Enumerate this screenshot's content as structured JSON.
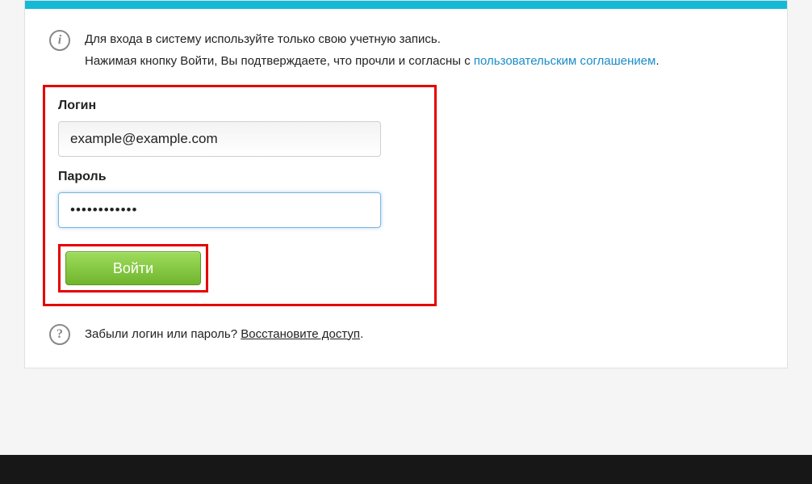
{
  "info": {
    "line1": "Для входа в систему используйте только свою учетную запись.",
    "line2_prefix": "Нажимая кнопку Войти, Вы подтверждаете, что прочли и согласны с ",
    "link_text": "пользовательским соглашением",
    "line2_suffix": "."
  },
  "form": {
    "login_label": "Логин",
    "login_value": "example@example.com",
    "password_label": "Пароль",
    "password_value": "••••••••••••",
    "submit_label": "Войти"
  },
  "help": {
    "prefix": "Забыли логин или пароль? ",
    "link_text": "Восстановите доступ",
    "suffix": "."
  },
  "icons": {
    "info_glyph": "i",
    "help_glyph": "?"
  }
}
